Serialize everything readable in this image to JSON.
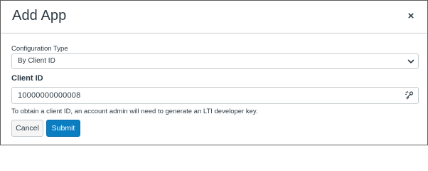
{
  "dialog": {
    "title": "Add App",
    "close_symbol": "×"
  },
  "configuration": {
    "label": "Configuration Type",
    "selected": "By Client ID"
  },
  "client_id": {
    "label": "Client ID",
    "value": "10000000000008",
    "hint": "To obtain a client ID, an account admin will need to generate an LTI developer key."
  },
  "buttons": {
    "cancel": "Cancel",
    "submit": "Submit"
  },
  "icons": {
    "close": "close-icon",
    "select_arrow": "chevron-down-icon",
    "input_extension": "password-manager-icon"
  },
  "colors": {
    "primary": "#0b7dc1",
    "text": "#2d3b45",
    "border": "#c7cdd1"
  }
}
